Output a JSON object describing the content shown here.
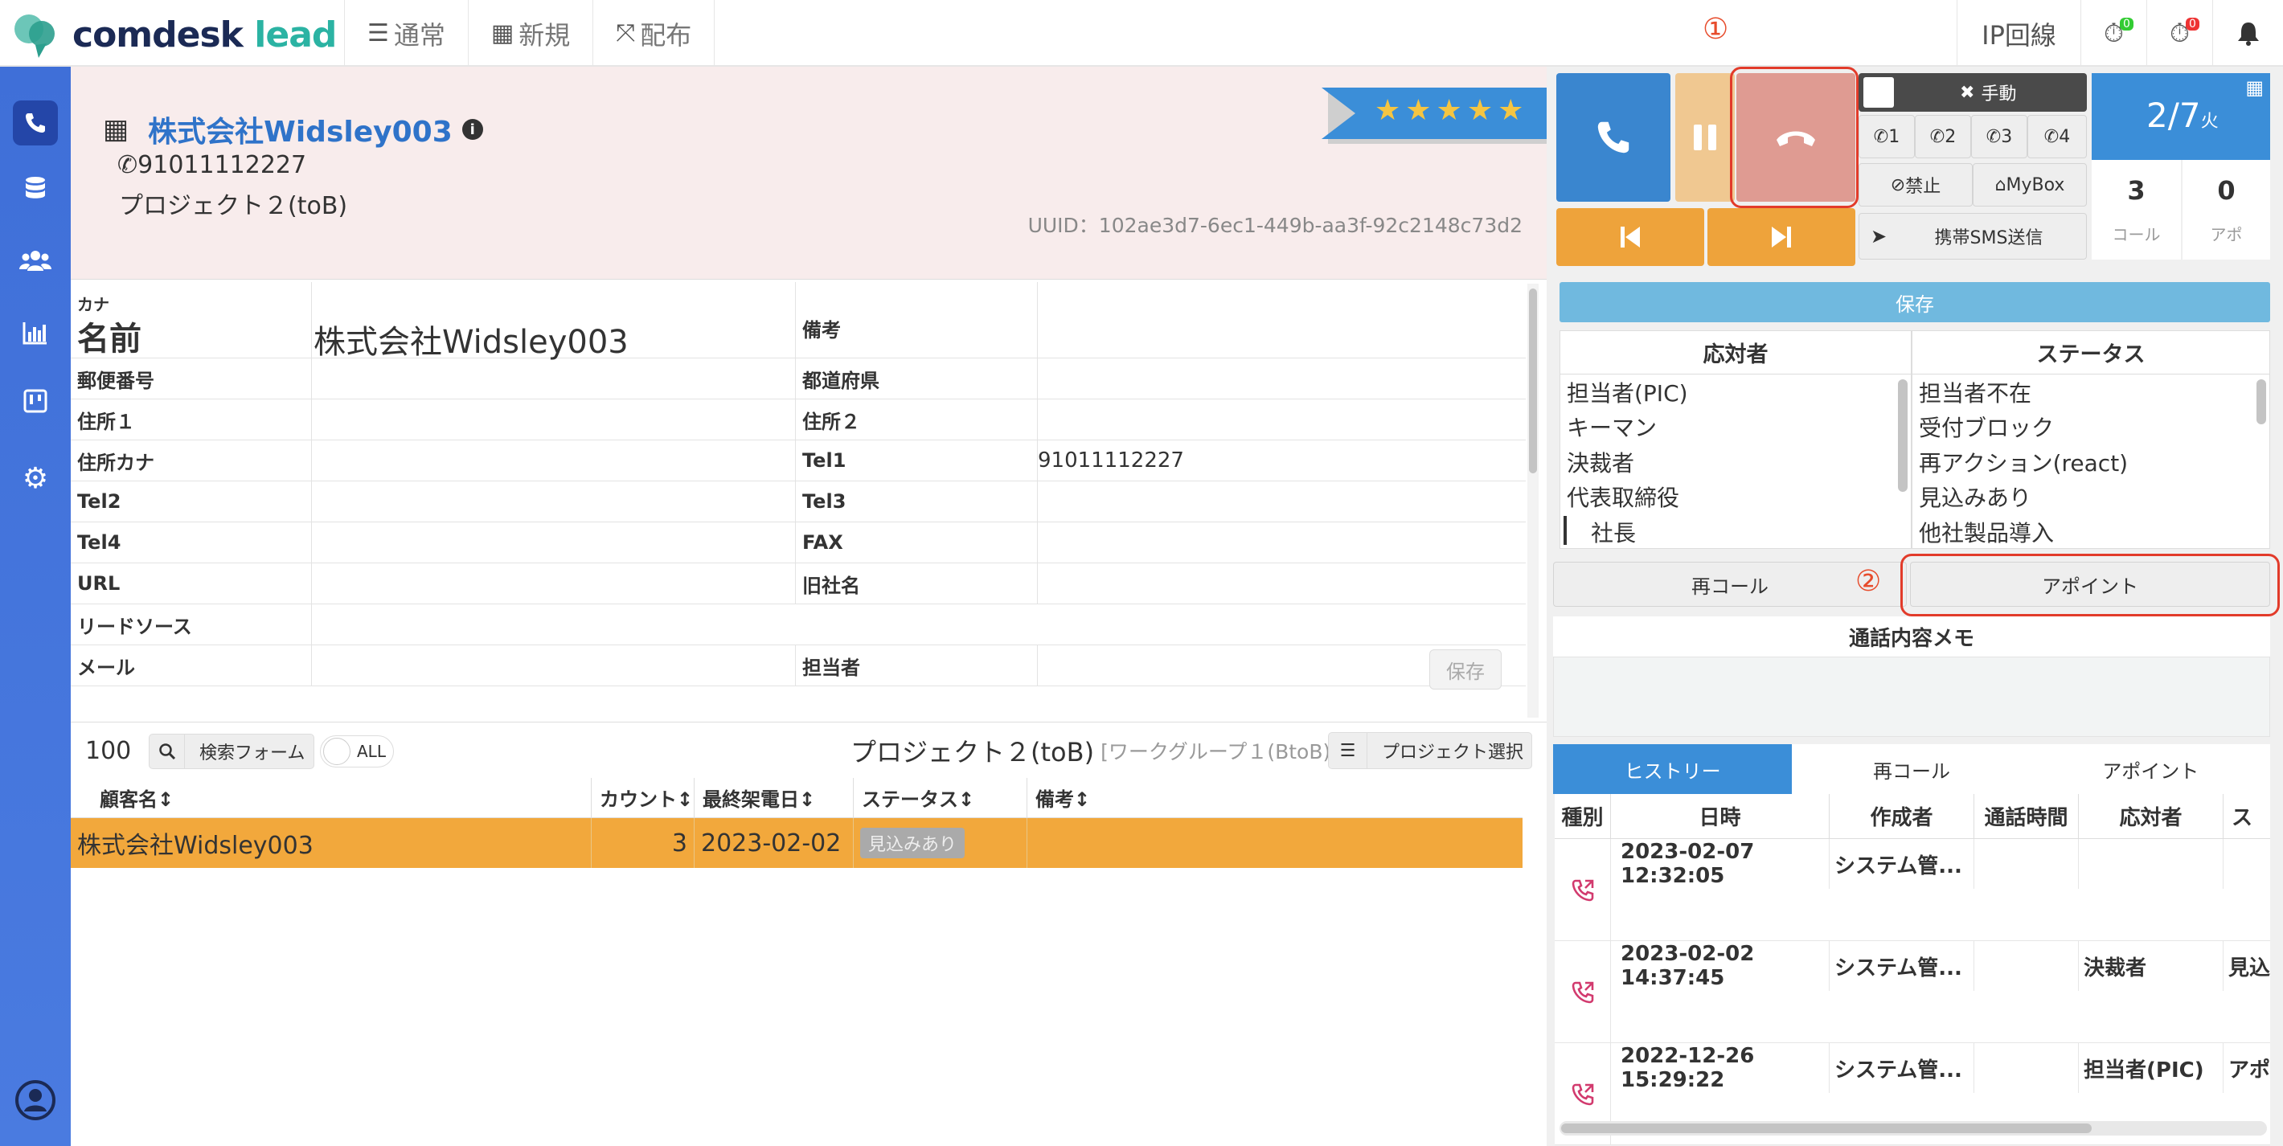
{
  "brand": {
    "name": "comdesk",
    "accent": "lead"
  },
  "nav": [
    {
      "icon": "list-icon",
      "label": "通常"
    },
    {
      "icon": "grid-icon",
      "label": "新規"
    },
    {
      "icon": "expand-icon",
      "label": "配布"
    }
  ],
  "annotations": {
    "one": "①",
    "two": "②"
  },
  "topright": {
    "line": "IP回線",
    "badge1": "0",
    "badge2": "0"
  },
  "company": {
    "name": "株式会社Widsley003",
    "phone": "91011112227",
    "project": "プロジェクト２(toB)",
    "uuid": "UUID：102ae3d7-6ec1-449b-aa3f-92c2148c73d2",
    "rating": 5
  },
  "form": {
    "kana_label": "カナ",
    "name_label": "名前",
    "name_value": "株式会社Widsley003",
    "memo_label": "備考",
    "rows": [
      {
        "l1": "郵便番号",
        "v1": "",
        "l2": "都道府県",
        "v2": ""
      },
      {
        "l1": "住所１",
        "v1": "",
        "l2": "住所２",
        "v2": ""
      },
      {
        "l1": "住所カナ",
        "v1": "",
        "l2": "Tel1",
        "v2": "91011112227"
      },
      {
        "l1": "Tel2",
        "v1": "",
        "l2": "Tel3",
        "v2": ""
      },
      {
        "l1": "Tel4",
        "v1": "",
        "l2": "FAX",
        "v2": ""
      },
      {
        "l1": "URL",
        "v1": "",
        "l2": "旧社名",
        "v2": ""
      },
      {
        "l1": "リードソース",
        "v1": "",
        "l2": "",
        "v2": ""
      },
      {
        "l1": "メール",
        "v1": "",
        "l2": "担当者",
        "v2": ""
      }
    ],
    "save": "保存"
  },
  "list": {
    "count": "100",
    "search_label": "検索フォーム",
    "all_label": "ALL",
    "title": "プロジェクト２(toB)",
    "subtitle": "[ワークグループ１(BtoB)]",
    "project_select": "プロジェクト選択",
    "columns": [
      "顧客名↕",
      "カウント↕",
      "最終架電日↕",
      "ステータス↕",
      "備考↕"
    ],
    "rows": [
      {
        "name": "株式会社Widsley003",
        "count": "3",
        "date": "2023-02-02",
        "status": "見込みあり",
        "memo": ""
      }
    ]
  },
  "phone": {
    "manual_label": "手動",
    "lines": [
      "1",
      "2",
      "3",
      "4"
    ],
    "forbid_label": "禁止",
    "mybox_label": "MyBox",
    "sms_label": "携帯SMS送信",
    "date": "2/7",
    "weekday": "火",
    "calls": "3",
    "calls_label": "コール",
    "apo": "0",
    "apo_label": "アポ"
  },
  "save_bar": "保存",
  "responder": {
    "header": "応対者",
    "items": [
      "担当者(PIC)",
      "キーマン",
      "決裁者",
      "代表取締役",
      "社長"
    ]
  },
  "status": {
    "header": "ステータス",
    "items": [
      "担当者不在",
      "受付ブロック",
      "再アクション(react)",
      "見込みあり",
      "他社製品導入"
    ]
  },
  "actions": {
    "recall": "再コール",
    "appoint": "アポイント"
  },
  "memo": {
    "title": "通話内容メモ"
  },
  "history": {
    "tabs": [
      "ヒストリー",
      "再コール",
      "アポイント"
    ],
    "columns": [
      "種別",
      "日時",
      "作成者",
      "通話時間",
      "応対者",
      "ス"
    ],
    "rows": [
      {
        "datetime": "2023-02-07 12:32:05",
        "creator": "システム管...",
        "duration": "",
        "responder": "",
        "status": ""
      },
      {
        "datetime": "2023-02-02 14:37:45",
        "creator": "システム管...",
        "duration": "",
        "responder": "決裁者",
        "status": "見込"
      },
      {
        "datetime": "2022-12-26 15:29:22",
        "creator": "システム管...",
        "duration": "",
        "responder": "担当者(PIC)",
        "status": "アポ"
      }
    ]
  },
  "colors": {
    "sidebar": "#3f6fd8",
    "call": "#3a86cf",
    "hangup": "#df9b92",
    "hold": "#f0c891",
    "highlight": "#f2a83c",
    "annotation": "#e23b2a"
  }
}
